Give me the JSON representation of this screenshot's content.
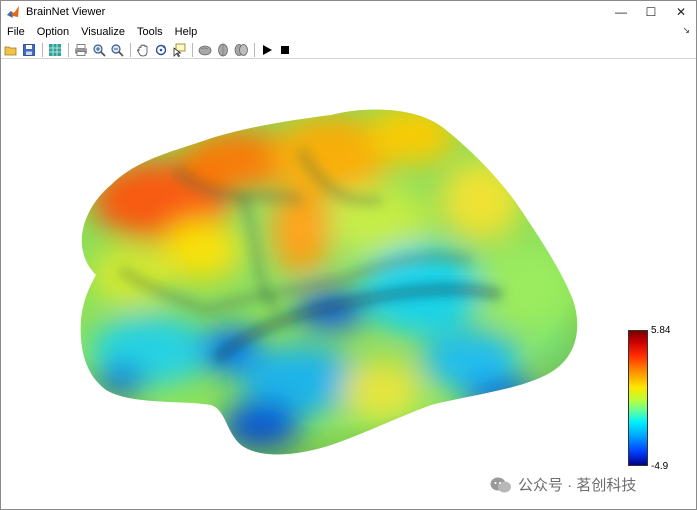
{
  "window": {
    "title": "BrainNet Viewer",
    "controls": {
      "minimize": "—",
      "maximize": "☐",
      "close": "✕"
    }
  },
  "menubar": {
    "items": [
      "File",
      "Option",
      "Visualize",
      "Tools",
      "Help"
    ],
    "dock_arrow": "↘"
  },
  "toolbar": {
    "icons": [
      "open-icon",
      "save-icon",
      "grid-icon",
      "print-icon",
      "zoom-in-icon",
      "zoom-out-icon",
      "pan-icon",
      "rotate-icon",
      "data-cursor-icon",
      "view-lateral-icon",
      "view-medial-icon",
      "view-full-icon",
      "play-icon",
      "stop-icon"
    ]
  },
  "colorbar": {
    "max_label": "5.84",
    "min_label": "-4.9",
    "colormap": [
      "#7a0000",
      "#ff2a00",
      "#ff8c00",
      "#ffe600",
      "#b4ff3c",
      "#00f0ff",
      "#00a8ff",
      "#0040ff",
      "#00008c"
    ]
  },
  "watermark": {
    "text": "公众号 · 茗创科技"
  }
}
